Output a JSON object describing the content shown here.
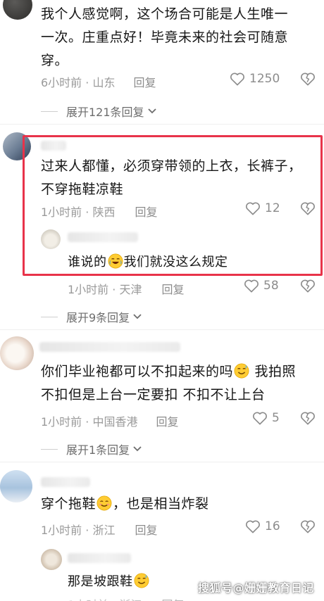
{
  "comments": [
    {
      "text": "我个人感觉啊，这个场合可能是人生唯一一次。庄重点好！毕竟未来的社会可随意穿。",
      "line1": "我个人感觉啊，这个场合可能是人生唯一",
      "line2": "一次。庄重点好！毕竟未来的社会可随意",
      "line3": "穿。",
      "time": "6小时前 · 山东",
      "reply": "回复",
      "likes": "1250",
      "expand": "展开121条回复"
    },
    {
      "line1": "过来人都懂，必须穿带领的上衣，长裤子，",
      "line2": "不穿拖鞋凉鞋",
      "time": "1小时前 · 陕西",
      "reply": "回复",
      "likes": "12"
    },
    {
      "text_before": "谁说的",
      "text_after": "我们就没这么规定",
      "time": "1小时前 · 天津",
      "reply": "回复",
      "likes": "58",
      "expand": "展开9条回复"
    },
    {
      "line1": "你们毕业袍都可以不扣起来的吗",
      "line1_after": " 我拍照",
      "line2": "不扣但是上台一定要扣 不扣不让上台",
      "time": "1小时前 · 中国香港",
      "reply": "回复",
      "likes": "5",
      "expand": "展开1条回复"
    },
    {
      "text_before": "穿个拖鞋",
      "text_after": "，也是相当炸裂",
      "time": "1小时前 · 浙江",
      "reply": "回复",
      "likes": "16"
    },
    {
      "text_before": "那是坡跟鞋",
      "time": "1小时前 · 浙江",
      "reply": "回复"
    }
  ],
  "watermark": "搜狐号@姗姗教育日记",
  "colors": {
    "highlight": "#e8334a",
    "meta": "#9a9a9a",
    "text": "#161616"
  },
  "icons": [
    "heart-outline-icon",
    "broken-heart-icon",
    "chevron-down-icon",
    "crying-laughing-emoji",
    "smiling-emoji",
    "sweat-emoji"
  ]
}
